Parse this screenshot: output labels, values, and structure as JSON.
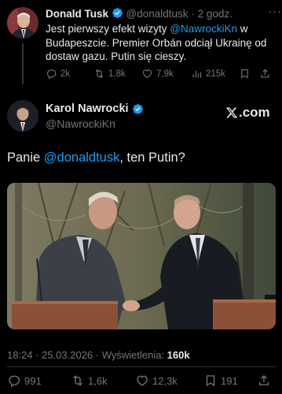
{
  "quoted": {
    "author_name": "Donald Tusk",
    "handle": "@donaldtusk",
    "time": "· 2 godz.",
    "more": "···",
    "text_before": "Jest pierwszy efekt wizyty ",
    "mention": "@NawrockiKn",
    "text_after": " w Budapeszcie. Premier Orbán odciął Ukrainę od dostaw gazu. Putin się cieszy.",
    "stats": {
      "replies": "2k",
      "reposts": "1,8k",
      "likes": "7,9k",
      "views": "215k"
    }
  },
  "tweet": {
    "author_name": "Karol Nawrocki",
    "handle": "@NawrockiKn",
    "brand": ".com",
    "text_before": "Panie ",
    "mention": "@donaldtusk",
    "text_after": ", ten Putin?",
    "timestamp": "18:24 · 25.03.2026 · Wyświetlenia: ",
    "views": "160k",
    "stats": {
      "replies": "991",
      "reposts": "1,6k",
      "likes": "12,3k",
      "bookmarks": "191"
    }
  },
  "colors": {
    "background": "#000000",
    "text": "#e7e9ea",
    "muted": "#71767b",
    "link": "#1d9bf0",
    "verified": "#1d9bf0"
  }
}
